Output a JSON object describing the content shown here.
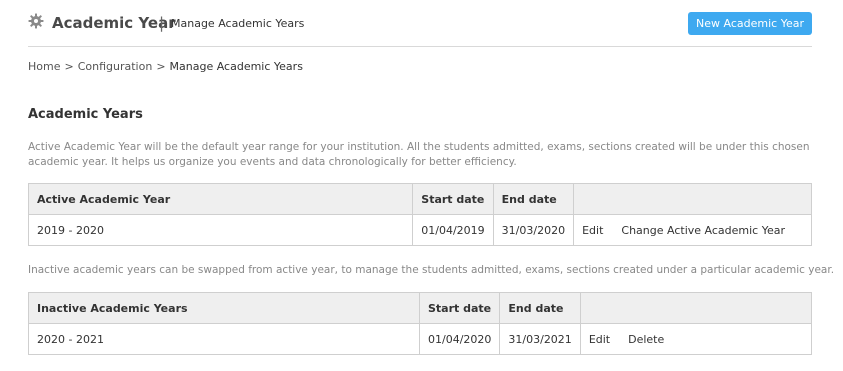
{
  "header": {
    "title": "Academic Year",
    "separator": "|",
    "subtitle": "Manage Academic Years",
    "new_button": "New Academic Year",
    "icon": "gear-icon"
  },
  "breadcrumb": {
    "items": [
      "Home",
      "Configuration",
      "Manage Academic Years"
    ],
    "separator": ">"
  },
  "section": {
    "title": "Academic Years",
    "description": "Active Academic Year will be the default year range for your institution. All the students admitted, exams, sections created will be under this chosen academic year. It helps us organize you events and data chronologically for better efficiency.",
    "inactive_description": "Inactive academic years can be swapped from active year, to manage the students admitted, exams, sections created under a particular academic year."
  },
  "active_table": {
    "columns": [
      "Active Academic Year",
      "Start date",
      "End date",
      ""
    ],
    "rows": [
      {
        "year": "2019 - 2020",
        "start": "01/04/2019",
        "end": "31/03/2020",
        "actions": [
          "Edit",
          "Change Active Academic Year"
        ]
      }
    ]
  },
  "inactive_table": {
    "columns": [
      "Inactive Academic Years",
      "Start date",
      "End date",
      ""
    ],
    "rows": [
      {
        "year": "2020 - 2021",
        "start": "01/04/2020",
        "end": "31/03/2021",
        "actions": [
          "Edit",
          "Delete"
        ]
      }
    ]
  },
  "colors": {
    "accent": "#3ea9f0",
    "header_bg": "#efefef",
    "border": "#cfcfcf",
    "muted_text": "#888888"
  }
}
